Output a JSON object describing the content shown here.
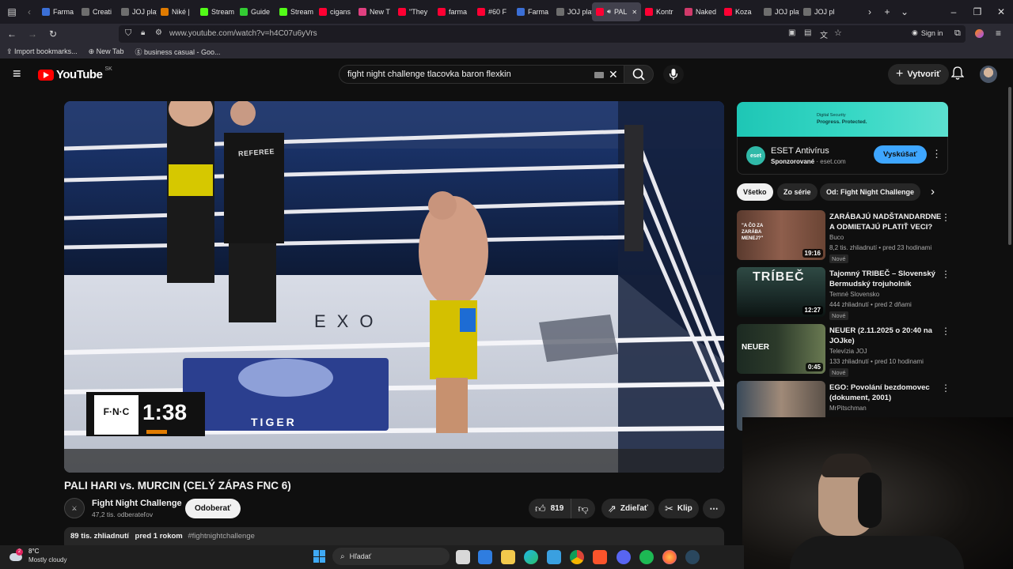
{
  "browser": {
    "tabs": [
      {
        "label": "Farma",
        "color": "#3b6fd6"
      },
      {
        "label": "Creati",
        "color": "#6e6e6e"
      },
      {
        "label": "JOJ play",
        "color": "#6e6e6e"
      },
      {
        "label": "Niké |",
        "color": "#e07b00"
      },
      {
        "label": "Stream",
        "color": "#53fc18"
      },
      {
        "label": "Guide",
        "color": "#33cc33"
      },
      {
        "label": "Stream",
        "color": "#53fc18"
      },
      {
        "label": "cigans",
        "color": "#ff0033"
      },
      {
        "label": "New T",
        "color": "#e04080"
      },
      {
        "label": "\"They",
        "color": "#ff0033"
      },
      {
        "label": "farma",
        "color": "#ff0033"
      },
      {
        "label": "#60 F",
        "color": "#ff0033"
      },
      {
        "label": "Farma",
        "color": "#3b6fd6"
      },
      {
        "label": "JOJ play",
        "color": "#6e6e6e"
      },
      {
        "label": "PAL",
        "color": "#ff0033"
      },
      {
        "label": "Kontr",
        "color": "#ff0033"
      },
      {
        "label": "Naked",
        "color": "#d03a6a"
      },
      {
        "label": "Koza",
        "color": "#ff0033"
      },
      {
        "label": "JOJ play",
        "color": "#6e6e6e"
      },
      {
        "label": "JOJ pl",
        "color": "#6e6e6e"
      }
    ],
    "url": "www.youtube.com/watch?v=h4C07u6yVrs",
    "sign_in": "Sign in",
    "bookmarks": [
      "Import bookmarks...",
      "New Tab",
      "business casual - Goo..."
    ]
  },
  "youtube": {
    "logo": "YouTube",
    "region": "SK",
    "search_value": "fight night challenge tlacovka baron flexkin",
    "create_label": "Vytvoriť"
  },
  "video": {
    "overlay_brand": "F·N·C",
    "overlay_time": "1:38",
    "title": "PALI HARI vs. MURCIN (CELÝ ZÁPAS FNC 6)",
    "channel_name": "Fight Night Challenge",
    "subscribers": "47,2 tis. odberateľov",
    "subscribe_label": "Odoberať",
    "likes": "819",
    "share_label": "Zdieľať",
    "clip_label": "Klip",
    "views": "89 tis. zhliadnutí",
    "age": "pred 1 rokom",
    "hashtag": "#fightnightchallenge",
    "referee_text": "REFEREE",
    "ring_text": "EXO",
    "mat_text": "TIGER"
  },
  "ad": {
    "banner_line1": "Digital Security",
    "banner_line2": "Progress. Protected.",
    "logo_text": "eset",
    "title": "ESET Antivírus",
    "sponsored": "Sponzorované",
    "domain": "eset.com",
    "cta": "Vyskúšať"
  },
  "filters": [
    "Všetko",
    "Zo série",
    "Od: Fight Night Challenge"
  ],
  "recommendations": [
    {
      "title": "ZARÁBAJÚ NADŠTANDARDNE A ODMIETAJÚ PLATIŤ VECI?",
      "channel": "Buco",
      "meta": "8,2 tis. zhliadnutí • pred 23 hodinami",
      "badge": "Nové",
      "duration": "19:16",
      "thumb_text": "\"A ČO ZA ZARÁBA MENEJ?\""
    },
    {
      "title": "Tajomný TRIBEČ – Slovenský Bermudský trojuholník",
      "channel": "Temné Slovensko",
      "meta": "444 zhliadnutí • pred 2 dňami",
      "badge": "Nové",
      "duration": "12:27",
      "thumb_text": "TRÍBEČ"
    },
    {
      "title": "NEUER (2.11.2025 o 20:40 na JOJke)",
      "channel": "Televízia JOJ",
      "meta": "133 zhliadnutí • pred 10 hodinami",
      "badge": "Nové",
      "duration": "0:45",
      "thumb_text": "NEUER"
    },
    {
      "title": "EGO: Povolání bezdomovec (dokument, 2001)",
      "channel": "MrPitschman",
      "meta": "",
      "badge": "",
      "duration": "",
      "thumb_text": ""
    }
  ],
  "taskbar": {
    "temperature": "8°C",
    "weather": "Mostly cloudy",
    "search_placeholder": "Hľadať",
    "badge_count": "2"
  }
}
